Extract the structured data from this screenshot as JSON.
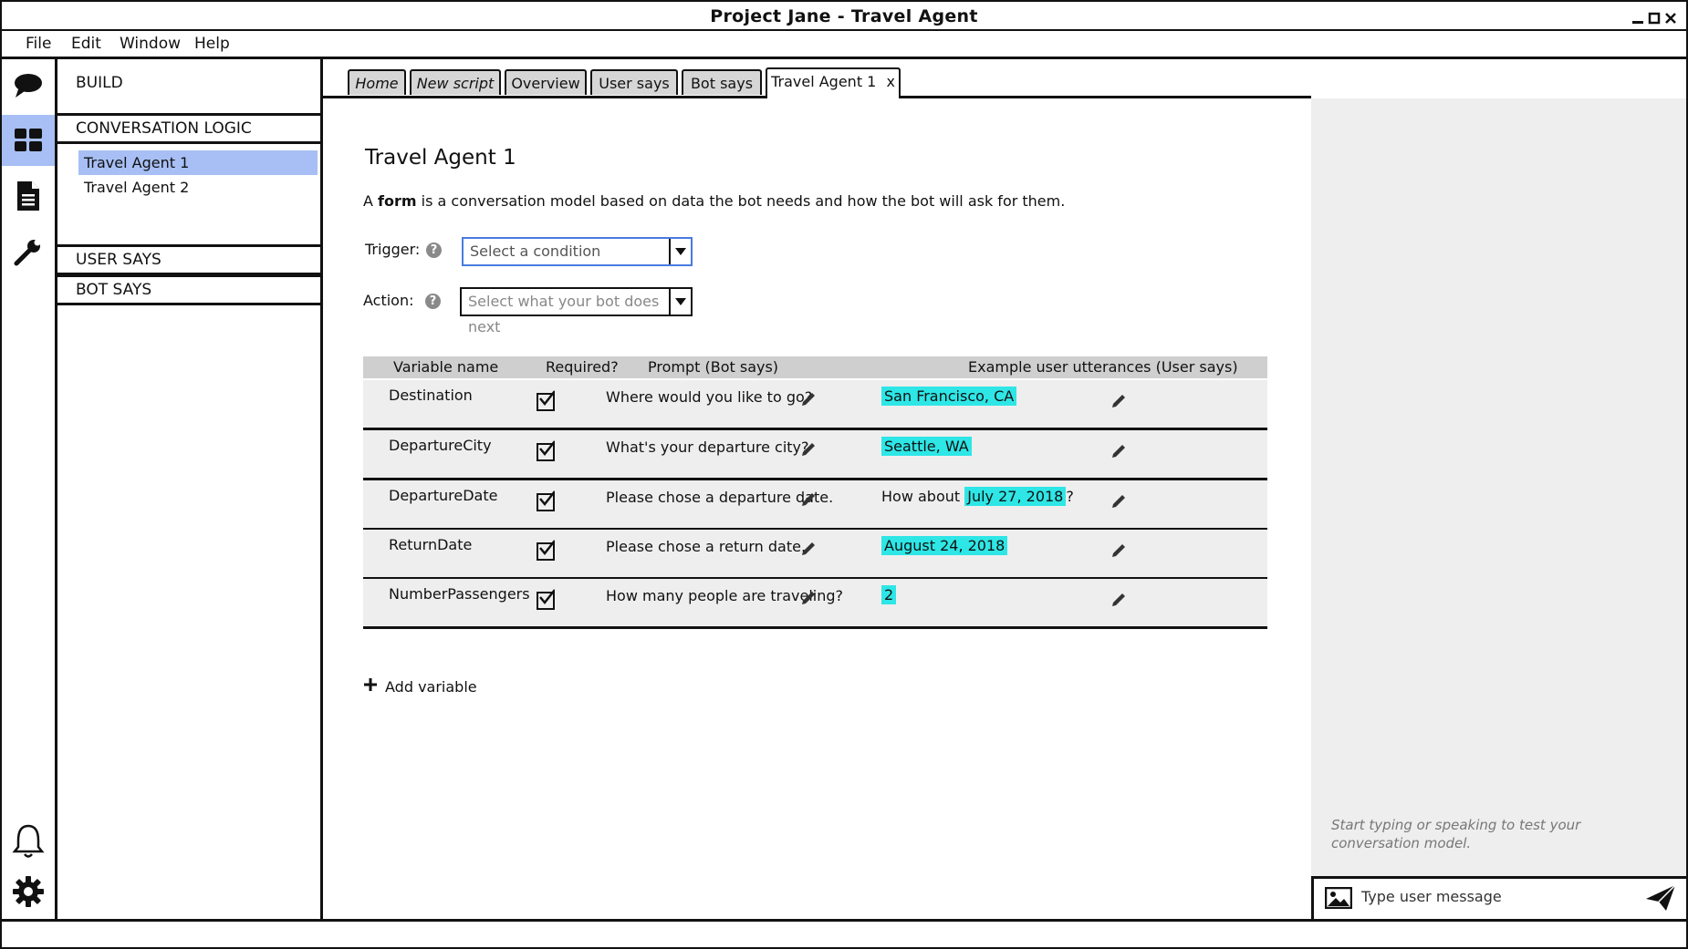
{
  "window": {
    "title": "Project Jane - Travel Agent",
    "controls": [
      "minimize-icon",
      "maximize-icon",
      "close-icon"
    ]
  },
  "menu": {
    "file": "File",
    "edit": "Edit",
    "window": "Window",
    "help": "Help"
  },
  "rail": {
    "icons": [
      "chat-icon",
      "dashboard-icon",
      "document-icon",
      "wrench-icon",
      "bell-icon",
      "gear-icon"
    ],
    "active": "dashboard-icon"
  },
  "sidebar": {
    "build": "BUILD",
    "conversation_logic": "CONVERSATION LOGIC",
    "items": [
      {
        "label": "Travel Agent 1",
        "selected": true
      },
      {
        "label": "Travel Agent 2",
        "selected": false
      }
    ],
    "user_says": "USER SAYS",
    "bot_says": "BOT SAYS"
  },
  "tabs": [
    {
      "label": "Home"
    },
    {
      "label": "New script"
    },
    {
      "label": "Overview"
    },
    {
      "label": "User says"
    },
    {
      "label": "Bot says"
    },
    {
      "label": "Travel Agent 1",
      "close": "x",
      "active": true
    }
  ],
  "form": {
    "title": "Travel Agent 1",
    "desc_prefix": "A ",
    "desc_bold": "form",
    "desc_suffix": " is a conversation model based on data the bot needs and how the bot will ask for them.",
    "trigger_label": "Trigger:",
    "trigger_placeholder": "Select a condition",
    "action_label": "Action:",
    "action_placeholder": "Select what your bot does next",
    "help": "?"
  },
  "table": {
    "headers": [
      "Variable name",
      "Required?",
      "Prompt (Bot says)",
      "Example user utterances (User says)"
    ],
    "rows": [
      {
        "name": "Destination",
        "required": true,
        "prompt": "Where would you like to go?",
        "utt_pre": "",
        "utt_hl": "San Francisco, CA",
        "utt_post": ""
      },
      {
        "name": "DepartureCity",
        "required": true,
        "prompt": "What's your departure city?",
        "utt_pre": "",
        "utt_hl": "Seattle, WA",
        "utt_post": ""
      },
      {
        "name": "DepartureDate",
        "required": true,
        "prompt": "Please chose a departure date.",
        "utt_pre": "How about ",
        "utt_hl": "July 27, 2018",
        "utt_post": "?"
      },
      {
        "name": "ReturnDate",
        "required": true,
        "prompt": "Please chose a return date.",
        "utt_pre": "",
        "utt_hl": "August 24, 2018",
        "utt_post": ""
      },
      {
        "name": "NumberPassengers",
        "required": true,
        "prompt": "How many people are traveling?",
        "utt_pre": "",
        "utt_hl": "2",
        "utt_post": ""
      }
    ],
    "add_variable": "Add variable"
  },
  "test_pane": {
    "hint": "Start typing or speaking to test your conversation model.",
    "input_placeholder": "Type user message"
  },
  "colors": {
    "selected": "#a7bff4",
    "highlight": "#2ee6e6",
    "tab_bg": "#d6d6d6",
    "row_bg": "#eeeeee"
  }
}
